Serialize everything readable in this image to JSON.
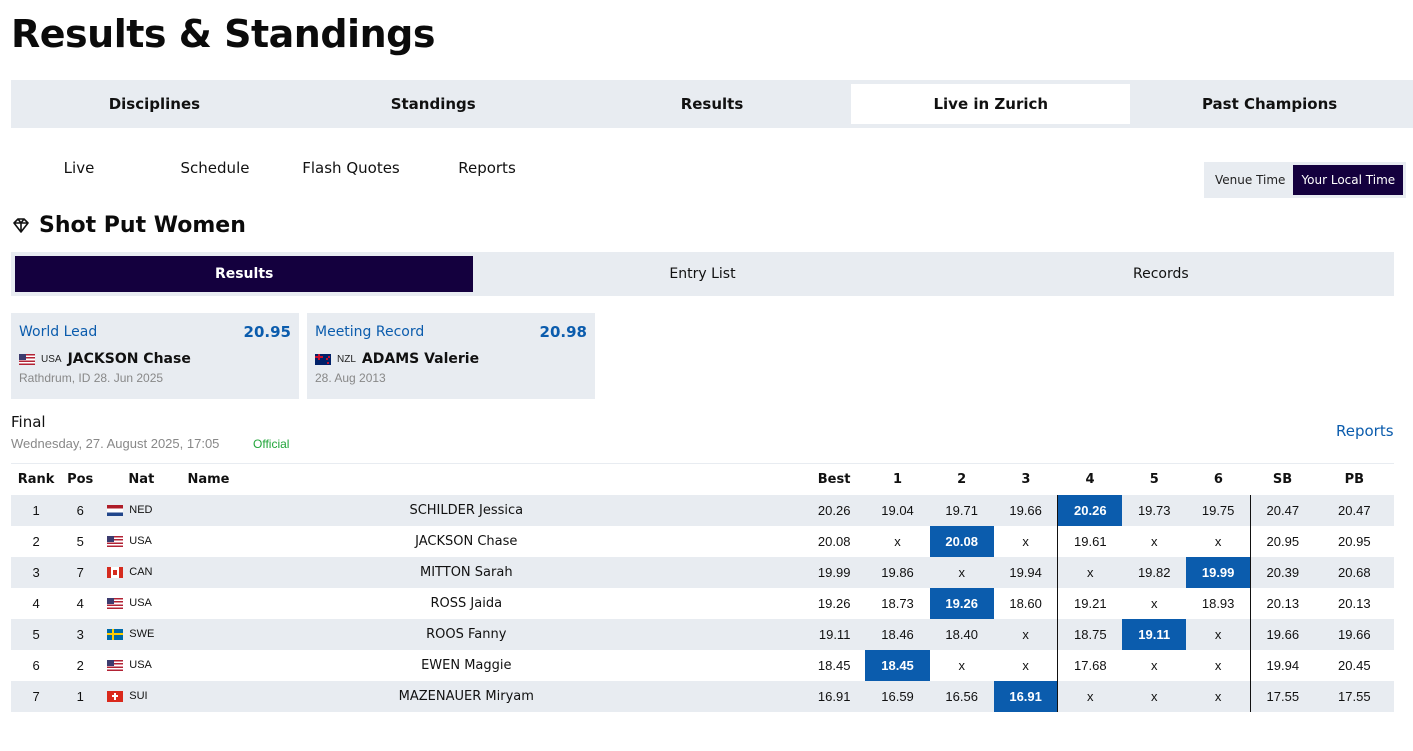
{
  "page": {
    "title": "Results & Standings"
  },
  "main_tabs": [
    {
      "label": "Disciplines",
      "active": false
    },
    {
      "label": "Standings",
      "active": false
    },
    {
      "label": "Results",
      "active": false
    },
    {
      "label": "Live in Zurich",
      "active": true
    },
    {
      "label": "Past Champions",
      "active": false
    }
  ],
  "sub_tabs": [
    {
      "label": "Live"
    },
    {
      "label": "Schedule"
    },
    {
      "label": "Flash Quotes"
    },
    {
      "label": "Reports"
    }
  ],
  "time_toggle": {
    "venue": "Venue Time",
    "local": "Your Local Time",
    "active": "local"
  },
  "event": {
    "title": "Shot Put Women",
    "icon": "diamond-icon",
    "tabs": [
      {
        "label": "Results",
        "active": true
      },
      {
        "label": "Entry List",
        "active": false
      },
      {
        "label": "Records",
        "active": false
      }
    ]
  },
  "records": [
    {
      "label": "World Lead",
      "mark": "20.95",
      "nat": "USA",
      "flag": "usa",
      "name": "JACKSON Chase",
      "meta": "Rathdrum, ID 28. Jun 2025"
    },
    {
      "label": "Meeting Record",
      "mark": "20.98",
      "nat": "NZL",
      "flag": "nzl",
      "name": "ADAMS Valerie",
      "meta": "28. Aug 2013"
    }
  ],
  "round": {
    "label": "Final",
    "date": "Wednesday, 27. August 2025, 17:05",
    "status": "Official",
    "status_color": "#22a53a",
    "reports_label": "Reports"
  },
  "table": {
    "headers": [
      "Rank",
      "Pos",
      "Nat",
      "Name",
      "Best",
      "1",
      "2",
      "3",
      "4",
      "5",
      "6",
      "SB",
      "PB"
    ],
    "highlight_color": "#0b5cad",
    "rows": [
      {
        "rank": "1",
        "pos": "6",
        "nat": "NED",
        "flag": "ned",
        "name": "SCHILDER Jessica",
        "best": "20.26",
        "attempts": [
          "19.04",
          "19.71",
          "19.66",
          "20.26",
          "19.73",
          "19.75"
        ],
        "best_attempt": 4,
        "sb": "20.47",
        "pb": "20.47"
      },
      {
        "rank": "2",
        "pos": "5",
        "nat": "USA",
        "flag": "usa",
        "name": "JACKSON Chase",
        "best": "20.08",
        "attempts": [
          "x",
          "20.08",
          "x",
          "19.61",
          "x",
          "x"
        ],
        "best_attempt": 2,
        "sb": "20.95",
        "pb": "20.95"
      },
      {
        "rank": "3",
        "pos": "7",
        "nat": "CAN",
        "flag": "can",
        "name": "MITTON Sarah",
        "best": "19.99",
        "attempts": [
          "19.86",
          "x",
          "19.94",
          "x",
          "19.82",
          "19.99"
        ],
        "best_attempt": 6,
        "sb": "20.39",
        "pb": "20.68"
      },
      {
        "rank": "4",
        "pos": "4",
        "nat": "USA",
        "flag": "usa",
        "name": "ROSS Jaida",
        "best": "19.26",
        "attempts": [
          "18.73",
          "19.26",
          "18.60",
          "19.21",
          "x",
          "18.93"
        ],
        "best_attempt": 2,
        "sb": "20.13",
        "pb": "20.13"
      },
      {
        "rank": "5",
        "pos": "3",
        "nat": "SWE",
        "flag": "swe",
        "name": "ROOS Fanny",
        "best": "19.11",
        "attempts": [
          "18.46",
          "18.40",
          "x",
          "18.75",
          "19.11",
          "x"
        ],
        "best_attempt": 5,
        "sb": "19.66",
        "pb": "19.66"
      },
      {
        "rank": "6",
        "pos": "2",
        "nat": "USA",
        "flag": "usa",
        "name": "EWEN Maggie",
        "best": "18.45",
        "attempts": [
          "18.45",
          "x",
          "x",
          "17.68",
          "x",
          "x"
        ],
        "best_attempt": 1,
        "sb": "19.94",
        "pb": "20.45"
      },
      {
        "rank": "7",
        "pos": "1",
        "nat": "SUI",
        "flag": "sui",
        "name": "MAZENAUER Miryam",
        "best": "16.91",
        "attempts": [
          "16.59",
          "16.56",
          "16.91",
          "x",
          "x",
          "x"
        ],
        "best_attempt": 3,
        "sb": "17.55",
        "pb": "17.55"
      }
    ]
  }
}
